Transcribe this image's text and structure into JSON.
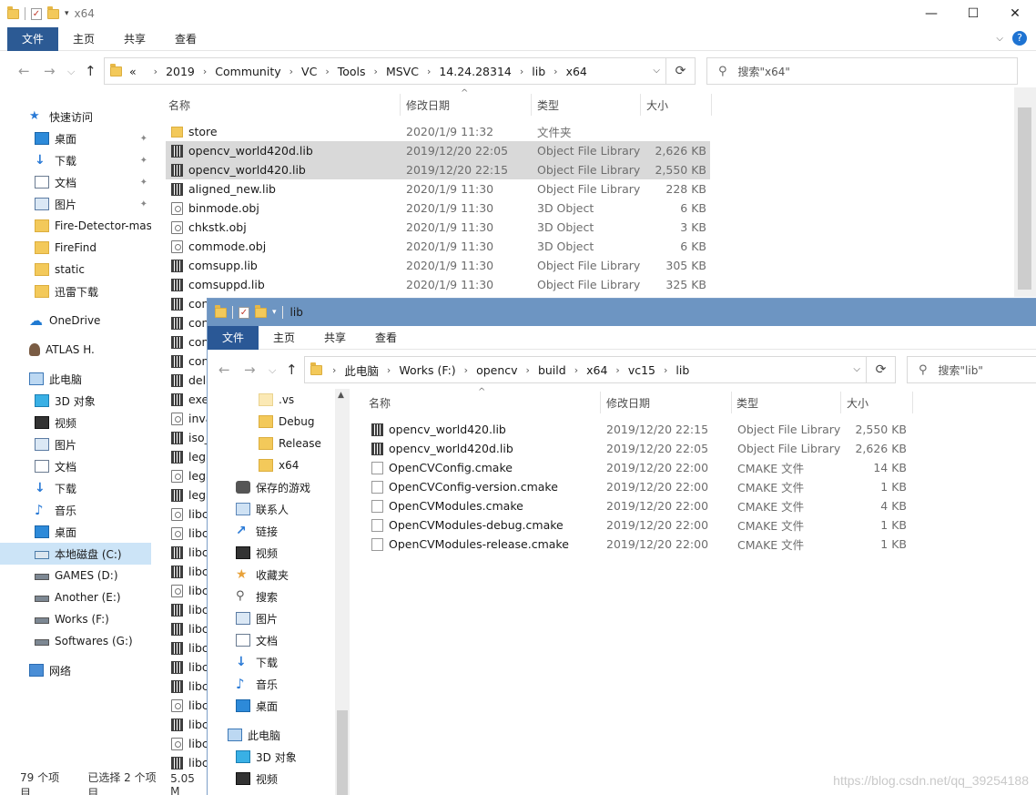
{
  "win1": {
    "title": "x64",
    "controls": [
      "—",
      "☐",
      "✕"
    ],
    "ribbon": {
      "file": "文件",
      "home": "主页",
      "share": "共享",
      "view": "查看"
    },
    "nav": {
      "back": "←",
      "forward": "→",
      "recent": "⌵",
      "up": "↑"
    },
    "address": [
      "«",
      "2019",
      "Community",
      "VC",
      "Tools",
      "MSVC",
      "14.24.28314",
      "lib",
      "x64"
    ],
    "search_placeholder": "搜索\"x64\"",
    "columns": {
      "name": "名称",
      "date": "修改日期",
      "type": "类型",
      "size": "大小"
    },
    "sidebar": [
      {
        "label": "快速访问",
        "icon": "star-icon"
      },
      {
        "label": "桌面",
        "icon": "desktop-icon",
        "pinned": true
      },
      {
        "label": "下载",
        "icon": "download-icon",
        "pinned": true
      },
      {
        "label": "文档",
        "icon": "document-icon",
        "pinned": true
      },
      {
        "label": "图片",
        "icon": "picture-icon",
        "pinned": true
      },
      {
        "label": "Fire-Detector-mas",
        "icon": "folder-icon"
      },
      {
        "label": "FireFind",
        "icon": "folder-icon"
      },
      {
        "label": "static",
        "icon": "folder-icon"
      },
      {
        "label": "迅雷下载",
        "icon": "folder-icon"
      },
      {
        "label": "OneDrive",
        "icon": "cloud-icon"
      },
      {
        "label": "ATLAS H.",
        "icon": "user-icon"
      },
      {
        "label": "此电脑",
        "icon": "computer-icon"
      },
      {
        "label": "3D 对象",
        "icon": "3d-objects-icon"
      },
      {
        "label": "视频",
        "icon": "video-icon"
      },
      {
        "label": "图片",
        "icon": "picture-icon"
      },
      {
        "label": "文档",
        "icon": "document-icon"
      },
      {
        "label": "下载",
        "icon": "download-icon"
      },
      {
        "label": "音乐",
        "icon": "music-icon"
      },
      {
        "label": "桌面",
        "icon": "desktop-icon"
      },
      {
        "label": "本地磁盘 (C:)",
        "icon": "local-disk-icon",
        "selected": true
      },
      {
        "label": "GAMES (D:)",
        "icon": "drive-icon"
      },
      {
        "label": "Another (E:)",
        "icon": "drive-icon"
      },
      {
        "label": "Works (F:)",
        "icon": "drive-icon"
      },
      {
        "label": "Softwares (G:)",
        "icon": "drive-icon"
      },
      {
        "label": "网络",
        "icon": "network-icon"
      }
    ],
    "files": [
      {
        "name": "store",
        "date": "2020/1/9 11:32",
        "type": "文件夹",
        "size": "",
        "kind": "fold"
      },
      {
        "name": "opencv_world420d.lib",
        "date": "2019/12/20 22:05",
        "type": "Object File Library",
        "size": "2,626 KB",
        "kind": "lib",
        "selected": true
      },
      {
        "name": "opencv_world420.lib",
        "date": "2019/12/20 22:15",
        "type": "Object File Library",
        "size": "2,550 KB",
        "kind": "lib",
        "selected": true
      },
      {
        "name": "aligned_new.lib",
        "date": "2020/1/9 11:30",
        "type": "Object File Library",
        "size": "228 KB",
        "kind": "lib"
      },
      {
        "name": "binmode.obj",
        "date": "2020/1/9 11:30",
        "type": "3D Object",
        "size": "6 KB",
        "kind": "obj"
      },
      {
        "name": "chkstk.obj",
        "date": "2020/1/9 11:30",
        "type": "3D Object",
        "size": "3 KB",
        "kind": "obj"
      },
      {
        "name": "commode.obj",
        "date": "2020/1/9 11:30",
        "type": "3D Object",
        "size": "6 KB",
        "kind": "obj"
      },
      {
        "name": "comsupp.lib",
        "date": "2020/1/9 11:30",
        "type": "Object File Library",
        "size": "305 KB",
        "kind": "lib"
      },
      {
        "name": "comsuppd.lib",
        "date": "2020/1/9 11:30",
        "type": "Object File Library",
        "size": "325 KB",
        "kind": "lib"
      },
      {
        "name": "con",
        "kind": "lib"
      },
      {
        "name": "con",
        "kind": "lib"
      },
      {
        "name": "con",
        "kind": "lib"
      },
      {
        "name": "con",
        "kind": "lib"
      },
      {
        "name": "dela",
        "kind": "lib"
      },
      {
        "name": "exe",
        "kind": "lib"
      },
      {
        "name": "inva",
        "kind": "obj"
      },
      {
        "name": "iso_",
        "kind": "lib"
      },
      {
        "name": "lega",
        "kind": "lib"
      },
      {
        "name": "lega",
        "kind": "obj"
      },
      {
        "name": "lega",
        "kind": "lib"
      },
      {
        "name": "libc",
        "kind": "obj"
      },
      {
        "name": "libc",
        "kind": "obj"
      },
      {
        "name": "libc",
        "kind": "lib"
      },
      {
        "name": "libc",
        "kind": "lib"
      },
      {
        "name": "libc",
        "kind": "obj"
      },
      {
        "name": "libc",
        "kind": "lib"
      },
      {
        "name": "libc",
        "kind": "lib"
      },
      {
        "name": "libc",
        "kind": "lib"
      },
      {
        "name": "libc",
        "kind": "lib"
      },
      {
        "name": "libc",
        "kind": "lib"
      },
      {
        "name": "libc",
        "kind": "obj"
      },
      {
        "name": "libc",
        "kind": "lib"
      },
      {
        "name": "libc",
        "kind": "obj"
      },
      {
        "name": "libc",
        "kind": "lib"
      }
    ],
    "status": {
      "count": "79 个项目",
      "selection": "已选择 2 个项目",
      "size": "5.05 M"
    }
  },
  "win2": {
    "title": "lib",
    "ribbon": {
      "file": "文件",
      "home": "主页",
      "share": "共享",
      "view": "查看"
    },
    "nav": {
      "back": "←",
      "forward": "→",
      "recent": "⌵",
      "up": "↑"
    },
    "address": [
      "此电脑",
      "Works (F:)",
      "opencv",
      "build",
      "x64",
      "vc15",
      "lib"
    ],
    "search_placeholder": "搜索\"lib\"",
    "columns": {
      "name": "名称",
      "date": "修改日期",
      "type": "类型",
      "size": "大小"
    },
    "sidebar": [
      {
        "label": ".vs",
        "icon": "folder-icon-light",
        "indent": 1
      },
      {
        "label": "Debug",
        "icon": "folder-icon",
        "indent": 1
      },
      {
        "label": "Release",
        "icon": "folder-icon",
        "indent": 1
      },
      {
        "label": "x64",
        "icon": "folder-icon",
        "indent": 1
      },
      {
        "label": "保存的游戏",
        "icon": "saved-games-icon",
        "indent": 0
      },
      {
        "label": "联系人",
        "icon": "contacts-icon",
        "indent": 0
      },
      {
        "label": "链接",
        "icon": "links-icon",
        "indent": 0
      },
      {
        "label": "视频",
        "icon": "video-icon",
        "indent": 0
      },
      {
        "label": "收藏夹",
        "icon": "favorites-icon",
        "indent": 0
      },
      {
        "label": "搜索",
        "icon": "search-icon",
        "indent": 0
      },
      {
        "label": "图片",
        "icon": "picture-icon",
        "indent": 0
      },
      {
        "label": "文档",
        "icon": "document-icon",
        "indent": 0
      },
      {
        "label": "下载",
        "icon": "download-icon",
        "indent": 0
      },
      {
        "label": "音乐",
        "icon": "music-icon",
        "indent": 0
      },
      {
        "label": "桌面",
        "icon": "desktop-icon",
        "indent": 0
      },
      {
        "label": "此电脑",
        "icon": "computer-icon",
        "indent": -1
      },
      {
        "label": "3D 对象",
        "icon": "3d-objects-icon",
        "indent": 0
      },
      {
        "label": "视频",
        "icon": "video-icon",
        "indent": 0
      }
    ],
    "files": [
      {
        "name": "opencv_world420.lib",
        "date": "2019/12/20 22:15",
        "type": "Object File Library",
        "size": "2,550 KB",
        "kind": "lib"
      },
      {
        "name": "opencv_world420d.lib",
        "date": "2019/12/20 22:05",
        "type": "Object File Library",
        "size": "2,626 KB",
        "kind": "lib"
      },
      {
        "name": "OpenCVConfig.cmake",
        "date": "2019/12/20 22:00",
        "type": "CMAKE 文件",
        "size": "14 KB",
        "kind": "cmake"
      },
      {
        "name": "OpenCVConfig-version.cmake",
        "date": "2019/12/20 22:00",
        "type": "CMAKE 文件",
        "size": "1 KB",
        "kind": "cmake"
      },
      {
        "name": "OpenCVModules.cmake",
        "date": "2019/12/20 22:00",
        "type": "CMAKE 文件",
        "size": "4 KB",
        "kind": "cmake"
      },
      {
        "name": "OpenCVModules-debug.cmake",
        "date": "2019/12/20 22:00",
        "type": "CMAKE 文件",
        "size": "1 KB",
        "kind": "cmake"
      },
      {
        "name": "OpenCVModules-release.cmake",
        "date": "2019/12/20 22:00",
        "type": "CMAKE 文件",
        "size": "1 KB",
        "kind": "cmake"
      }
    ]
  },
  "watermark": "https://blog.csdn.net/qq_39254188"
}
